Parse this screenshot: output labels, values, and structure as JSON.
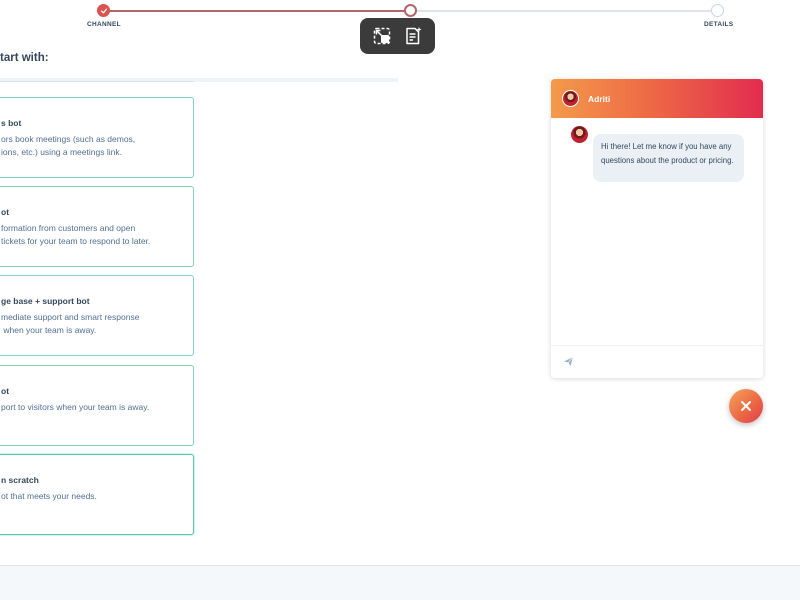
{
  "stepper": {
    "steps": [
      {
        "label": "CHANNEL",
        "state": "done"
      },
      {
        "label": "",
        "state": "current"
      },
      {
        "label": "DETAILS",
        "state": "todo"
      }
    ]
  },
  "overlay_toolbar": {
    "buttons": [
      {
        "icon": "picture-in-picture-icon"
      },
      {
        "icon": "document-sparkle-icon"
      }
    ]
  },
  "section": {
    "heading": "tart with:"
  },
  "templates": [
    {
      "title": "s bot",
      "description": "ors book meetings (such as demos,\nions, etc.) using a meetings link.",
      "selected": false
    },
    {
      "title": "ot",
      "description": "formation from customers and open\ntickets for your team to respond to later.",
      "selected": false
    },
    {
      "title": "ge base + support bot",
      "description": "mediate support and smart response\n when your team is away.",
      "selected": false
    },
    {
      "title": "ot",
      "description": "port to visitors when your team is away.",
      "selected": false
    },
    {
      "title": "n scratch",
      "description": "ot that meets your needs.",
      "selected": true
    }
  ],
  "chat_preview": {
    "agent_name": "Adriti",
    "message": "Hi there! Let me know if you have any questions about the product or pricing.",
    "send_icon": "paper-plane-icon",
    "header_gradient": [
      "#f49a4b",
      "#ee6b45",
      "#e22c4f"
    ]
  },
  "launcher": {
    "icon": "close-icon",
    "color": "#ec6a45"
  },
  "colors": {
    "accent": "#d9534f",
    "card_border": "#7fd1c5",
    "text": "#33475b"
  }
}
